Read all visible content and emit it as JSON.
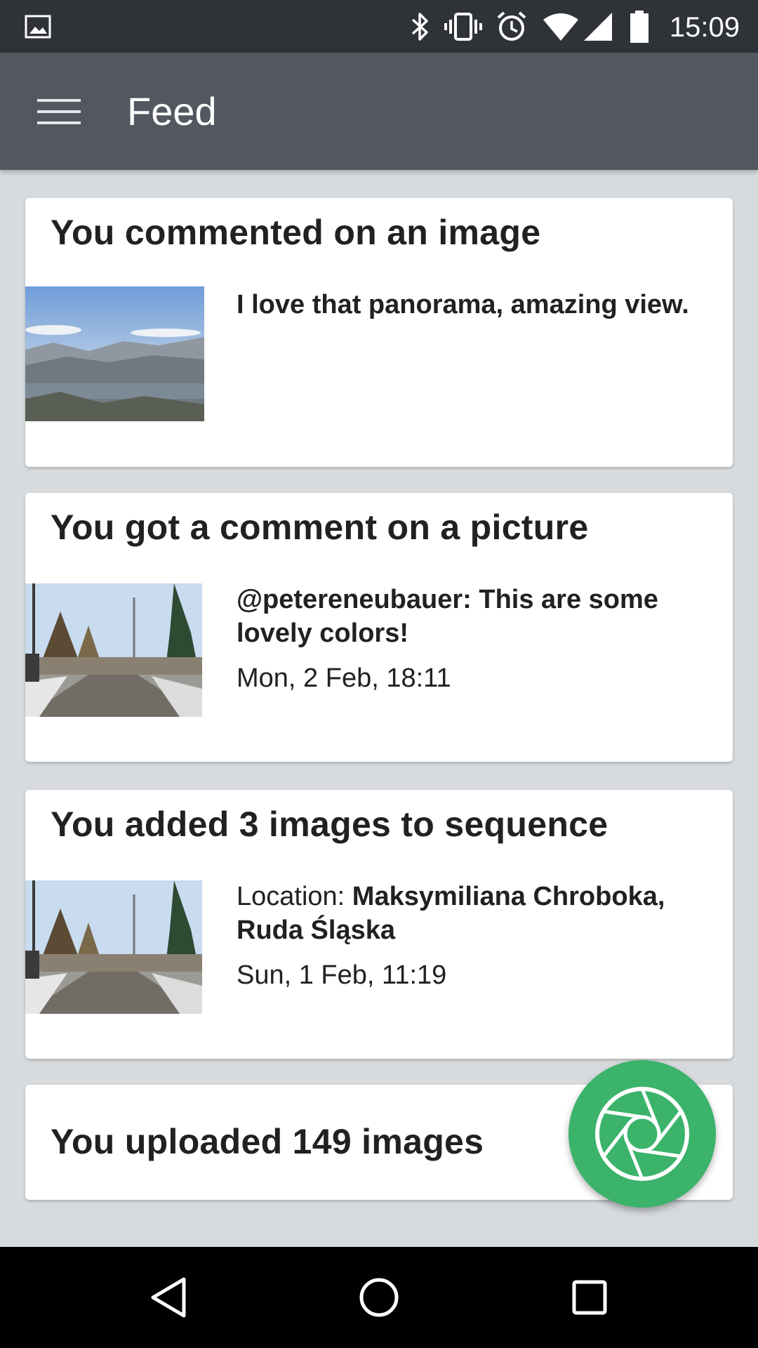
{
  "status_bar": {
    "time": "15:09",
    "icons": [
      "image-icon",
      "bluetooth-icon",
      "vibrate-icon",
      "alarm-icon",
      "wifi-icon",
      "cell-signal-icon",
      "battery-icon"
    ]
  },
  "app_bar": {
    "title": "Feed",
    "menu_icon": "hamburger-menu-icon"
  },
  "feed": {
    "items": [
      {
        "title": "You commented on an image",
        "comment": "I love that panorama, amazing view."
      },
      {
        "title": "You got a comment on a picture",
        "comment": "@petereneubauer: This are some lovely colors!",
        "timestamp": "Mon, 2 Feb, 18:11"
      },
      {
        "title": "You added  3 images to sequence",
        "location_label": "Location: ",
        "location_value": "Maksymiliana Chroboka, Ruda Śląska",
        "timestamp": "Sun, 1 Feb, 11:19"
      },
      {
        "title": "You uploaded 149 images"
      }
    ]
  },
  "fab": {
    "icon": "camera-aperture-icon"
  },
  "nav_bar": {
    "icons": [
      "back-icon",
      "home-icon",
      "recents-icon"
    ]
  },
  "colors": {
    "status_bar": "#2f3237",
    "app_bar": "#53575f",
    "background": "#d8dbde",
    "fab": "#3bb36b"
  }
}
